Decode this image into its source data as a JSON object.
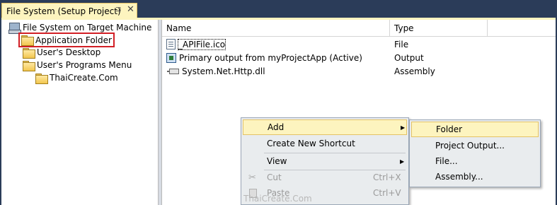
{
  "tab": {
    "title": "File System (Setup Project)",
    "pin_icon": "pin-icon",
    "close_icon": "close-icon",
    "close_glyph": "✕",
    "pin_glyph": "⊐"
  },
  "tree": {
    "root": "File System on Target Machine",
    "items": [
      {
        "label": "Application Folder",
        "selected": true
      },
      {
        "label": "User's Desktop"
      },
      {
        "label": "User's Programs Menu"
      },
      {
        "label": "ThaiCreate.Com"
      }
    ]
  },
  "list": {
    "columns": [
      "Name",
      "Type"
    ],
    "rows": [
      {
        "name": "_APIFile.ico",
        "type": "File",
        "icon": "file-icon"
      },
      {
        "name": "Primary output from myProjectApp (Active)",
        "type": "Output",
        "icon": "output-icon"
      },
      {
        "name": "System.Net.Http.dll",
        "type": "Assembly",
        "icon": "dll-icon"
      }
    ]
  },
  "context_menu": {
    "items": [
      {
        "label": "Add",
        "submenu": true,
        "highlighted": true
      },
      {
        "label": "Create New Shortcut"
      },
      {
        "label": "View",
        "submenu": true
      },
      {
        "label": "Cut",
        "shortcut": "Ctrl+X",
        "disabled": true
      },
      {
        "label": "Paste",
        "shortcut": "Ctrl+V",
        "disabled": true
      }
    ],
    "arrow_glyph": "▶"
  },
  "submenu": {
    "items": [
      {
        "label": "Folder",
        "highlighted": true
      },
      {
        "label": "Project Output..."
      },
      {
        "label": "File..."
      },
      {
        "label": "Assembly..."
      }
    ]
  },
  "watermark": "ThaiCreate.Com",
  "colors": {
    "background": "#2b3c59",
    "tab_active": "#fdf4bf",
    "highlight": "#fdf4bf",
    "selection_border": "#d21f26"
  }
}
